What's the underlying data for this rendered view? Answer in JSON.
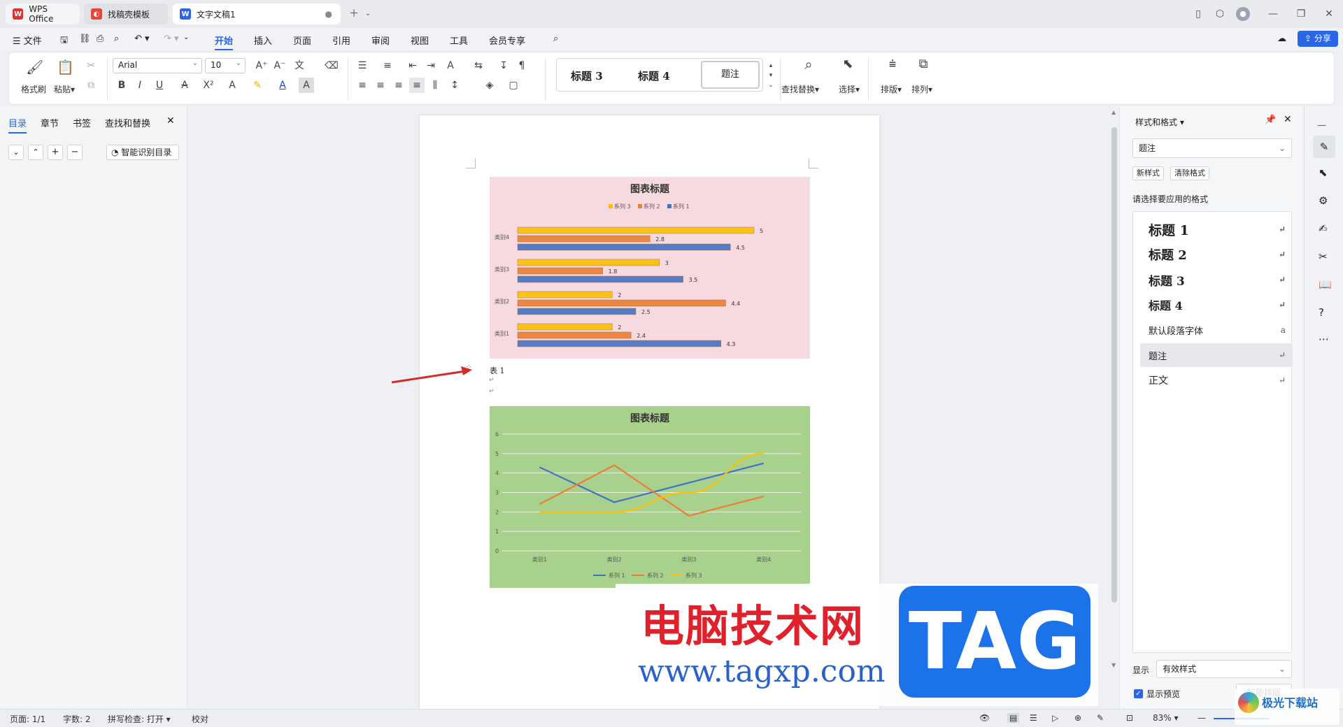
{
  "tabs": [
    {
      "label": "WPS Office"
    },
    {
      "label": "找稿壳模板"
    },
    {
      "label": "文字文稿1"
    }
  ],
  "menu": {
    "file": "文件",
    "items": [
      "开始",
      "插入",
      "页面",
      "引用",
      "审阅",
      "视图",
      "工具",
      "会员专享"
    ],
    "share": "分享"
  },
  "ribbon": {
    "format_painter": "格式刷",
    "paste": "粘贴",
    "font_name": "Arial",
    "font_size": "10",
    "styles": [
      "标题 3",
      "标题 4",
      "题注"
    ],
    "find_replace": "查找替换",
    "select": "选择",
    "layout": "排版",
    "arrange": "排列"
  },
  "left_panel": {
    "tabs": [
      "目录",
      "章节",
      "书签",
      "查找和替换"
    ],
    "smart_toc": "智能识别目录"
  },
  "chart1": {
    "title": "图表标题",
    "type": "bar",
    "categories": [
      "类别1",
      "类别2",
      "类别3",
      "类别4"
    ],
    "series": [
      {
        "name": "系列 3",
        "values": [
          2,
          2,
          3,
          5
        ]
      },
      {
        "name": "系列 2",
        "values": [
          2.4,
          4.4,
          1.8,
          2.8
        ]
      },
      {
        "name": "系列 1",
        "values": [
          4.3,
          2.5,
          3.5,
          4.5
        ]
      }
    ]
  },
  "caption": "表 1",
  "chart2": {
    "title": "图表标题",
    "type": "line",
    "categories": [
      "类别1",
      "类别2",
      "类别3",
      "类别4"
    ],
    "ylim": [
      0,
      6
    ],
    "yticks": [
      "0",
      "1",
      "2",
      "3",
      "4",
      "5",
      "6"
    ],
    "series": [
      {
        "name": "系列 1",
        "values": [
          4.3,
          2.5,
          3.5,
          4.5
        ]
      },
      {
        "name": "系列 2",
        "values": [
          2.4,
          4.4,
          1.8,
          2.8
        ]
      },
      {
        "name": "系列 3",
        "values": [
          2,
          2,
          3,
          5
        ]
      }
    ]
  },
  "chart_data": [
    {
      "type": "bar",
      "title": "图表标题",
      "categories": [
        "类别1",
        "类别2",
        "类别3",
        "类别4"
      ],
      "series": [
        {
          "name": "系列 1",
          "values": [
            4.3,
            2.5,
            3.5,
            4.5
          ]
        },
        {
          "name": "系列 2",
          "values": [
            2.4,
            4.4,
            1.8,
            2.8
          ]
        },
        {
          "name": "系列 3",
          "values": [
            2,
            2,
            3,
            5
          ]
        }
      ],
      "legend": "top",
      "orientation": "horizontal"
    },
    {
      "type": "line",
      "title": "图表标题",
      "categories": [
        "类别1",
        "类别2",
        "类别3",
        "类别4"
      ],
      "ylim": [
        0,
        6
      ],
      "series": [
        {
          "name": "系列 1",
          "values": [
            4.3,
            2.5,
            3.5,
            4.5
          ]
        },
        {
          "name": "系列 2",
          "values": [
            2.4,
            4.4,
            1.8,
            2.8
          ]
        },
        {
          "name": "系列 3",
          "values": [
            2,
            2,
            3,
            5
          ]
        }
      ],
      "legend": "bottom",
      "grid": true
    }
  ],
  "right_panel": {
    "title": "样式和格式",
    "current_style": "题注",
    "new_style": "新样式",
    "clear_format": "清除格式",
    "prompt": "请选择要应用的格式",
    "styles": [
      "标题 1",
      "标题 2",
      "标题 3",
      "标题 4",
      "默认段落字体",
      "题注",
      "正文"
    ],
    "show_label": "显示",
    "show_value": "有效样式",
    "preview": "显示预览",
    "smart_layout": "智能排版"
  },
  "status": {
    "page": "页面: 1/1",
    "words": "字数: 2",
    "spell": "拼写检查: 打开",
    "proof": "校对",
    "zoom": "83%"
  },
  "watermark": {
    "cn": "电脑技术网",
    "url": "www.tagxp.com",
    "tag": "TAG",
    "corner": "极光下载站"
  },
  "colors": {
    "accent": "#2b66e6",
    "chart1_bg": "#f6dadf",
    "chart2_bg": "#a9d18e",
    "s1": "#4472c4",
    "s2": "#ed7d31",
    "s3": "#ffc000"
  }
}
